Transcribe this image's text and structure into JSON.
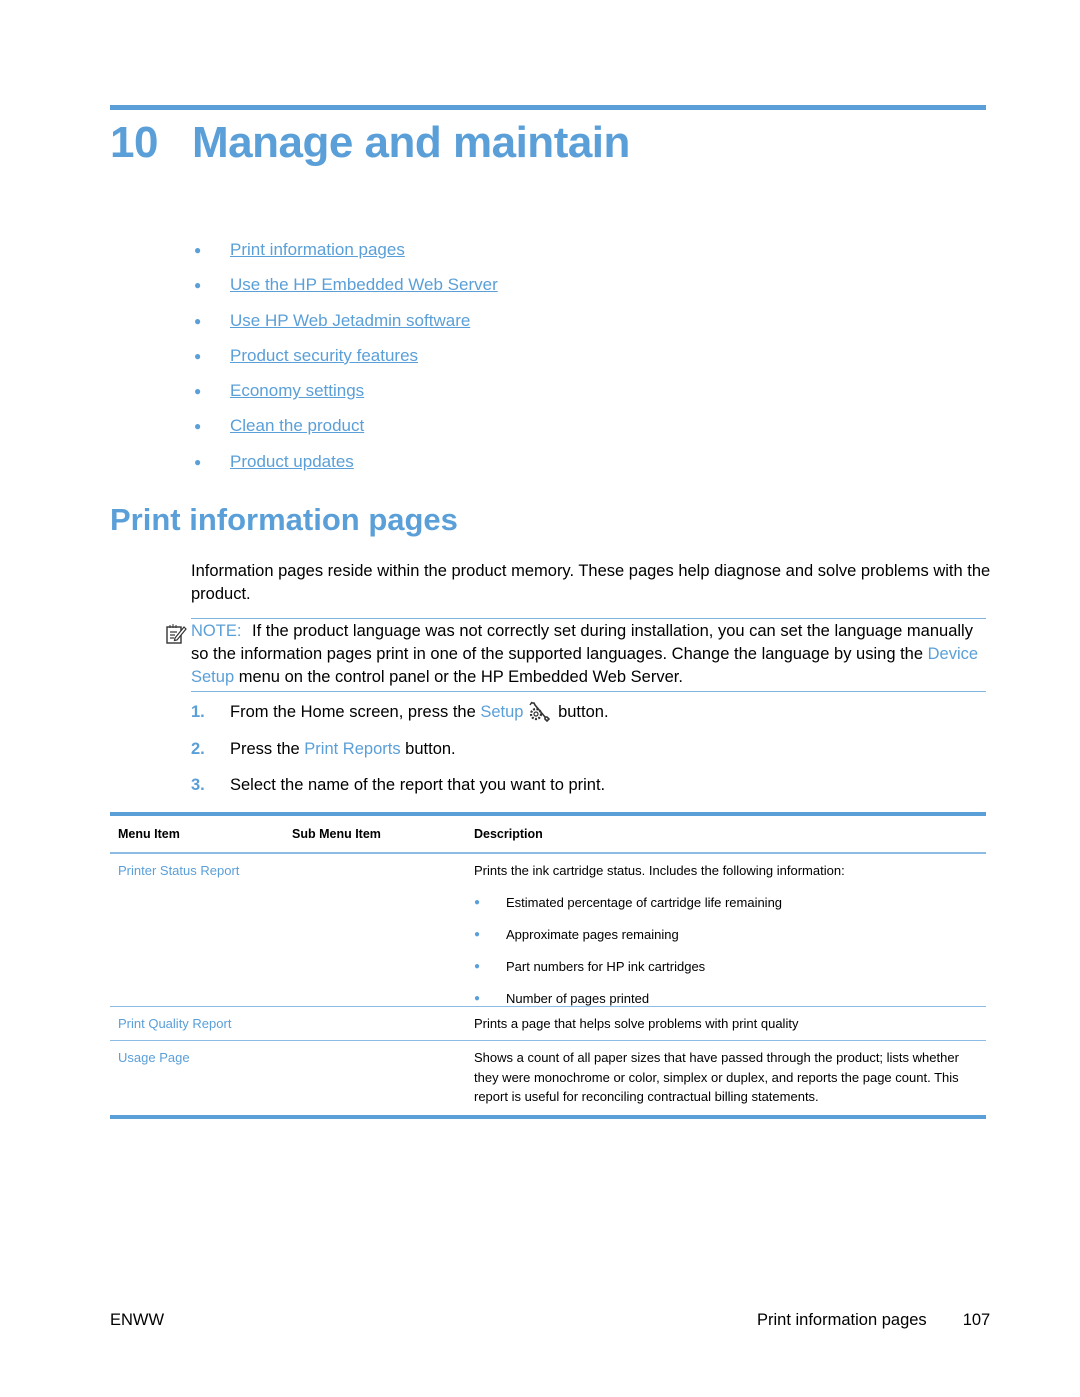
{
  "chapter": {
    "number": "10",
    "title": "Manage and maintain"
  },
  "toc": [
    {
      "label": "Print information pages"
    },
    {
      "label": "Use the HP Embedded Web Server"
    },
    {
      "label": "Use HP Web Jetadmin software"
    },
    {
      "label": "Product security features"
    },
    {
      "label": "Economy settings"
    },
    {
      "label": "Clean the product"
    },
    {
      "label": "Product updates"
    }
  ],
  "section": {
    "title": "Print information pages",
    "intro": "Information pages reside within the product memory. These pages help diagnose and solve problems with the product."
  },
  "note": {
    "label": "NOTE:",
    "text_before": "If the product language was not correctly set during installation, you can set the language manually so the information pages print in one of the supported languages. Change the language by using the ",
    "link": "Device Setup",
    "text_after": " menu on the control panel or the HP Embedded Web Server.",
    "icon": "note-pencil-icon"
  },
  "steps": [
    {
      "num": "1.",
      "before": "From the Home screen, press the ",
      "link": "Setup",
      "icon": "setup-wrench-gear-icon",
      "after": " button."
    },
    {
      "num": "2.",
      "before": "Press the ",
      "link": "Print Reports",
      "after": " button."
    },
    {
      "num": "3.",
      "text": "Select the name of the report that you want to print."
    }
  ],
  "table": {
    "headers": [
      "Menu Item",
      "Sub Menu Item",
      "Description"
    ],
    "rows": [
      {
        "menu_item": "Printer Status Report",
        "sub_menu_item": "",
        "description": "Prints the ink cartridge status. Includes the following information:",
        "bullets": [
          "Estimated percentage of cartridge life remaining",
          "Approximate pages remaining",
          "Part numbers for HP ink cartridges",
          "Number of pages printed"
        ]
      },
      {
        "menu_item": "Print Quality Report",
        "sub_menu_item": "",
        "description": "Prints a page that helps solve problems with print quality"
      },
      {
        "menu_item": "Usage Page",
        "sub_menu_item": "",
        "description": "Shows a count of all paper sizes that have passed through the product; lists whether they were monochrome or color, simplex or duplex, and reports the page count. This report is useful for reconciling contractual billing statements."
      }
    ]
  },
  "footer": {
    "left": "ENWW",
    "section": "Print information pages",
    "page": "107"
  },
  "colors": {
    "accent": "#5a9fd8",
    "rule": "#8cbbe5",
    "text": "#000000"
  }
}
